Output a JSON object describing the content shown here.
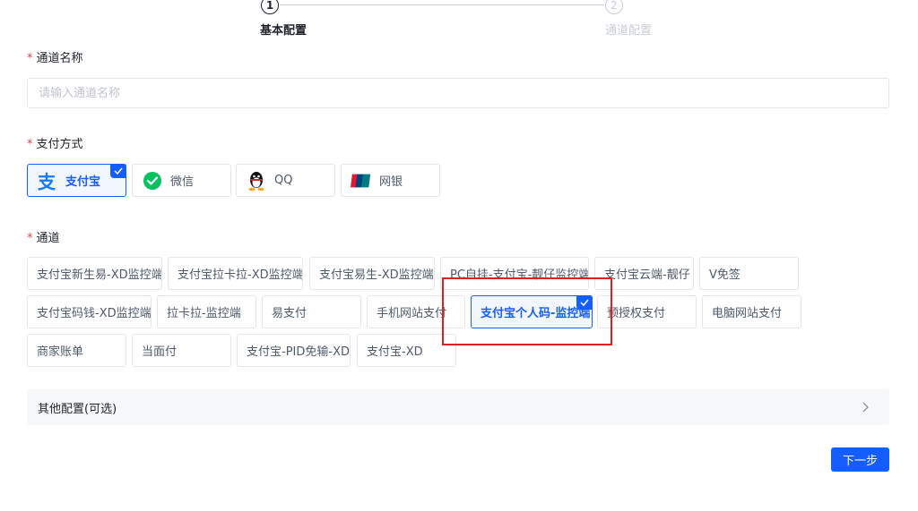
{
  "steps": [
    {
      "index": "1",
      "title": "基本配置"
    },
    {
      "index": "2",
      "title": "通道配置"
    }
  ],
  "form": {
    "channel_name": {
      "label": "通道名称",
      "placeholder": "请输入通道名称",
      "value": ""
    },
    "payment_method": {
      "label": "支付方式",
      "options": [
        "支付宝",
        "微信",
        "QQ",
        "网银"
      ],
      "selected": "支付宝"
    },
    "channel": {
      "label": "通道",
      "options": [
        "支付宝新生易-XD监控端",
        "支付宝拉卡拉-XD监控端",
        "支付宝易生-XD监控端",
        "PC自挂-支付宝-靓仔监控端",
        "支付宝云端-靓仔",
        "V免签",
        "支付宝码钱-XD监控端",
        "拉卡拉-监控端",
        "易支付",
        "手机网站支付",
        "支付宝个人码-监控端",
        "预授权支付",
        "电脑网站支付",
        "商家账单",
        "当面付",
        "支付宝-PID免输-XD",
        "支付宝-XD"
      ],
      "selected": "支付宝个人码-监控端"
    },
    "required_mark": "*"
  },
  "other_config": {
    "label": "其他配置(可选)"
  },
  "buttons": {
    "next": "下一步"
  },
  "colors": {
    "primary": "#165dff",
    "required": "#f53f3f",
    "annotation": "#e02020",
    "alipay": "#1677ff",
    "wechat": "#07c160"
  },
  "icons": {
    "alipay": "alipay-icon",
    "wechat": "wechat-icon",
    "qq": "qq-penguin-icon",
    "unionpay": "unionpay-icon",
    "check": "check-icon",
    "chevron": "chevron-right-icon"
  }
}
